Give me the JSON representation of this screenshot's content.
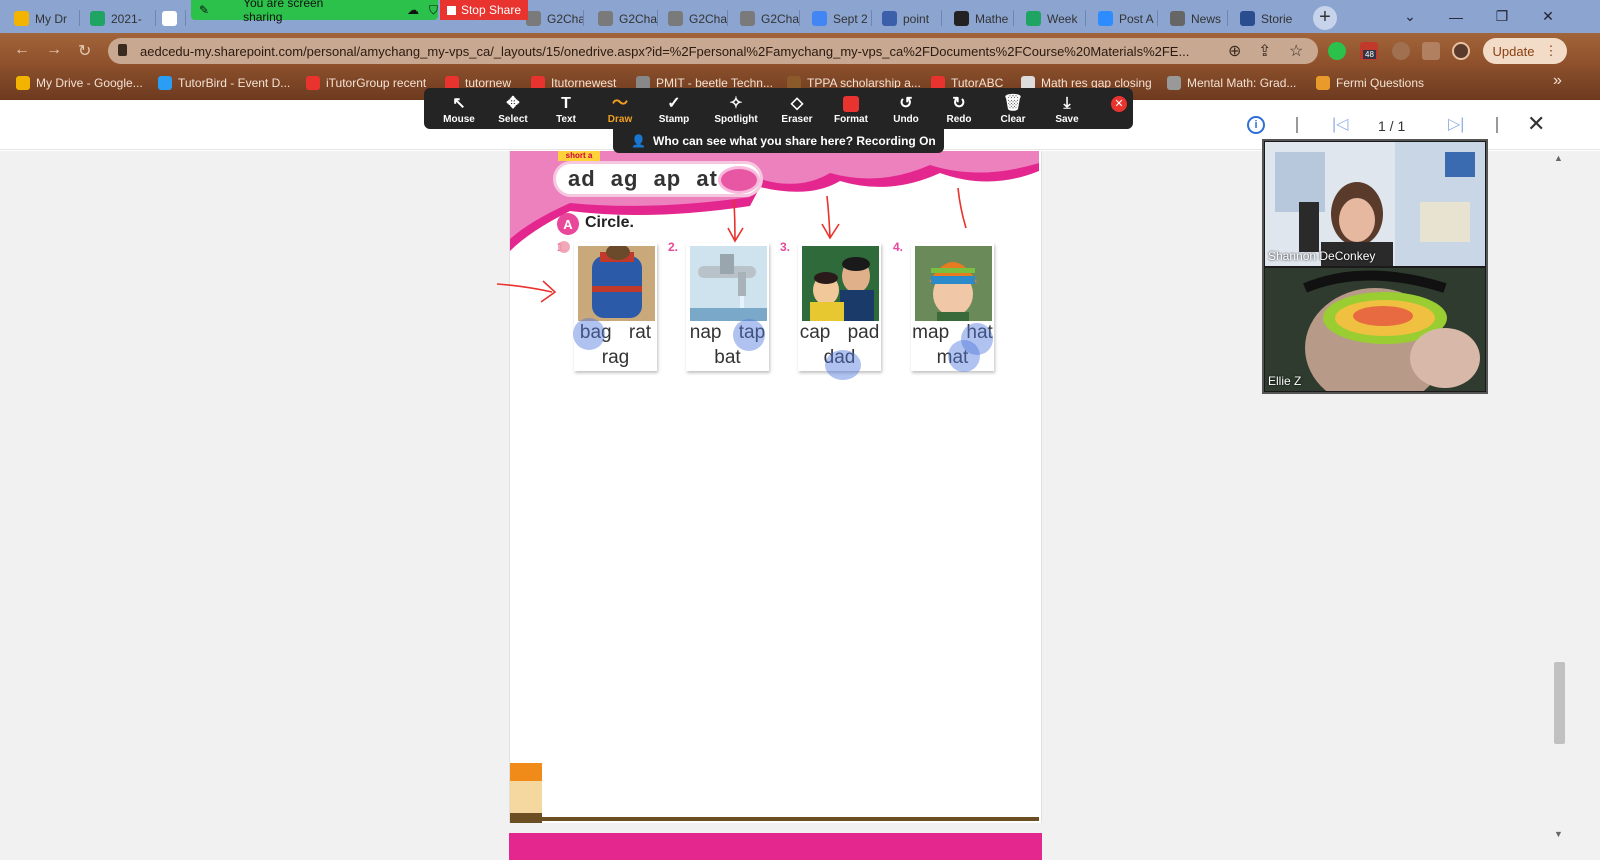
{
  "browser": {
    "tabs": [
      {
        "label": "My Dr",
        "color": "#f2b400"
      },
      {
        "label": "2021-",
        "color": "#1fa463"
      },
      {
        "label": "",
        "color": "#ffffff"
      },
      {
        "label": "",
        "color": "#ffffff"
      },
      {
        "label": "G2Cha",
        "color": "#7a7a7a"
      },
      {
        "label": "G2Cha",
        "color": "#7a7a7a"
      },
      {
        "label": "G2Cha",
        "color": "#7a7a7a"
      },
      {
        "label": "G2Cha",
        "color": "#7a7a7a"
      },
      {
        "label": "Sept 2",
        "color": "#4285f4"
      },
      {
        "label": "point",
        "color": "#3b5fa8"
      },
      {
        "label": "Mathe",
        "color": "#222222"
      },
      {
        "label": "Week",
        "color": "#1fa463"
      },
      {
        "label": "Post A",
        "color": "#2d8cff"
      },
      {
        "label": "News",
        "color": "#666666"
      },
      {
        "label": "Storie",
        "color": "#2a4d8f"
      }
    ],
    "address": "aedcedu-my.sharepoint.com/personal/amychang_my-vps_ca/_layouts/15/onedrive.aspx?id=%2Fpersonal%2Famychang_my-vps_ca%2FDocuments%2FCourse%20Materials%2FE...",
    "update_label": "Update",
    "extension_badge": "48",
    "bookmarks": [
      {
        "label": "My Drive - Google...",
        "color": "#f2b400"
      },
      {
        "label": "TutorBird - Event D...",
        "color": "#2a9df4"
      },
      {
        "label": "iTutorGroup recent",
        "color": "#e8332e"
      },
      {
        "label": "tutornew",
        "color": "#e8332e"
      },
      {
        "label": "Itutornewest",
        "color": "#e8332e"
      },
      {
        "label": "PMIT - beetle Techn...",
        "color": "#888888"
      },
      {
        "label": "TPPA scholarship a...",
        "color": "#8a5a2a"
      },
      {
        "label": "TutorABC",
        "color": "#e8332e"
      },
      {
        "label": "Math res gap closing",
        "color": "#dddddd"
      },
      {
        "label": "Mental Math: Grad...",
        "color": "#999999"
      },
      {
        "label": "Fermi Questions",
        "color": "#e89a2a"
      }
    ]
  },
  "zoom": {
    "sharing_label": "You are screen sharing",
    "stop_share_label": "Stop Share",
    "tools": [
      {
        "label": "Mouse",
        "glyph": "↖"
      },
      {
        "label": "Select",
        "glyph": "✥"
      },
      {
        "label": "Text",
        "glyph": "T"
      },
      {
        "label": "Draw",
        "glyph": "〜"
      },
      {
        "label": "Stamp",
        "glyph": "✓"
      },
      {
        "label": "Spotlight",
        "glyph": "✧"
      },
      {
        "label": "Eraser",
        "glyph": "◇"
      },
      {
        "label": "Format",
        "glyph": ""
      },
      {
        "label": "Undo",
        "glyph": "↺"
      },
      {
        "label": "Redo",
        "glyph": "↻"
      },
      {
        "label": "Clear",
        "glyph": "🗑"
      },
      {
        "label": "Save",
        "glyph": "⤓"
      }
    ],
    "active_tool": "Draw",
    "accent": "#f0a020",
    "recording_notice": "Who can see what you share here? Recording On",
    "participants": [
      {
        "name": "Shannon DeConkey"
      },
      {
        "name": "Ellie Z"
      }
    ]
  },
  "viewer": {
    "page_indicator": "1 / 1"
  },
  "worksheet": {
    "rule_tag": "short a",
    "rule_words": "ad ag ap at",
    "section_letter": "A",
    "section_title": "Circle.",
    "items": [
      {
        "num": "1.",
        "line1": "bag rat",
        "line2": "rag"
      },
      {
        "num": "2.",
        "line1": "nap tap",
        "line2": "bat"
      },
      {
        "num": "3.",
        "line1": "cap pad",
        "line2": "dad"
      },
      {
        "num": "4.",
        "line1": "map hat",
        "line2": "mat"
      }
    ]
  }
}
